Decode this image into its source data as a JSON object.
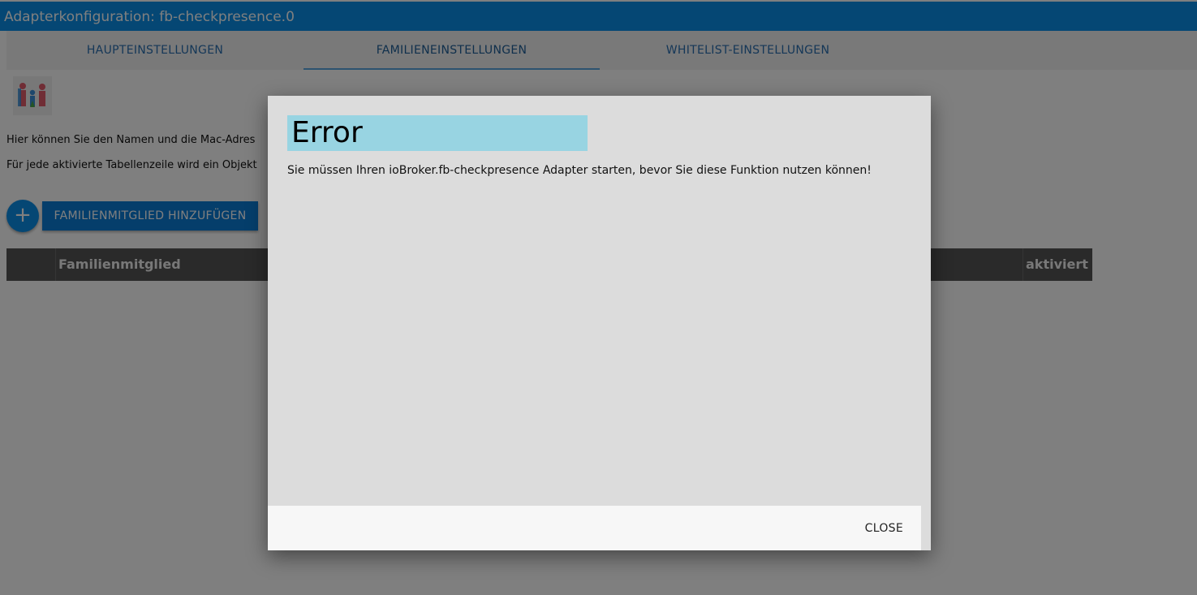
{
  "window": {
    "title": "Adapterkonfiguration: fb-checkpresence.0"
  },
  "tabs": [
    {
      "label": "HAUPTEINSTELLUNGEN"
    },
    {
      "label": "FAMILIENEINSTELLUNGEN"
    },
    {
      "label": "WHITELIST-EINSTELLUNGEN"
    }
  ],
  "content": {
    "description_1": "Hier können Sie den Namen und die Mac-Adres",
    "description_2": "Für jede aktivierte Tabellenzeile wird ein Objekt",
    "add_icon": "+",
    "add_button_label": "FAMILIENMITGLIED HINZUFÜGEN",
    "table": {
      "columns": [
        "Familienmitglied",
        "aktiviert"
      ]
    }
  },
  "dialog": {
    "title": "Error",
    "message": "Sie müssen Ihren ioBroker.fb-checkpresence Adapter starten, bevor Sie diese Funktion nutzen können!",
    "close_label": "CLOSE"
  },
  "colors": {
    "accent": "#0b8fe9",
    "dialog_title_bg": "#98d4e2",
    "table_header_bg": "#555555"
  }
}
